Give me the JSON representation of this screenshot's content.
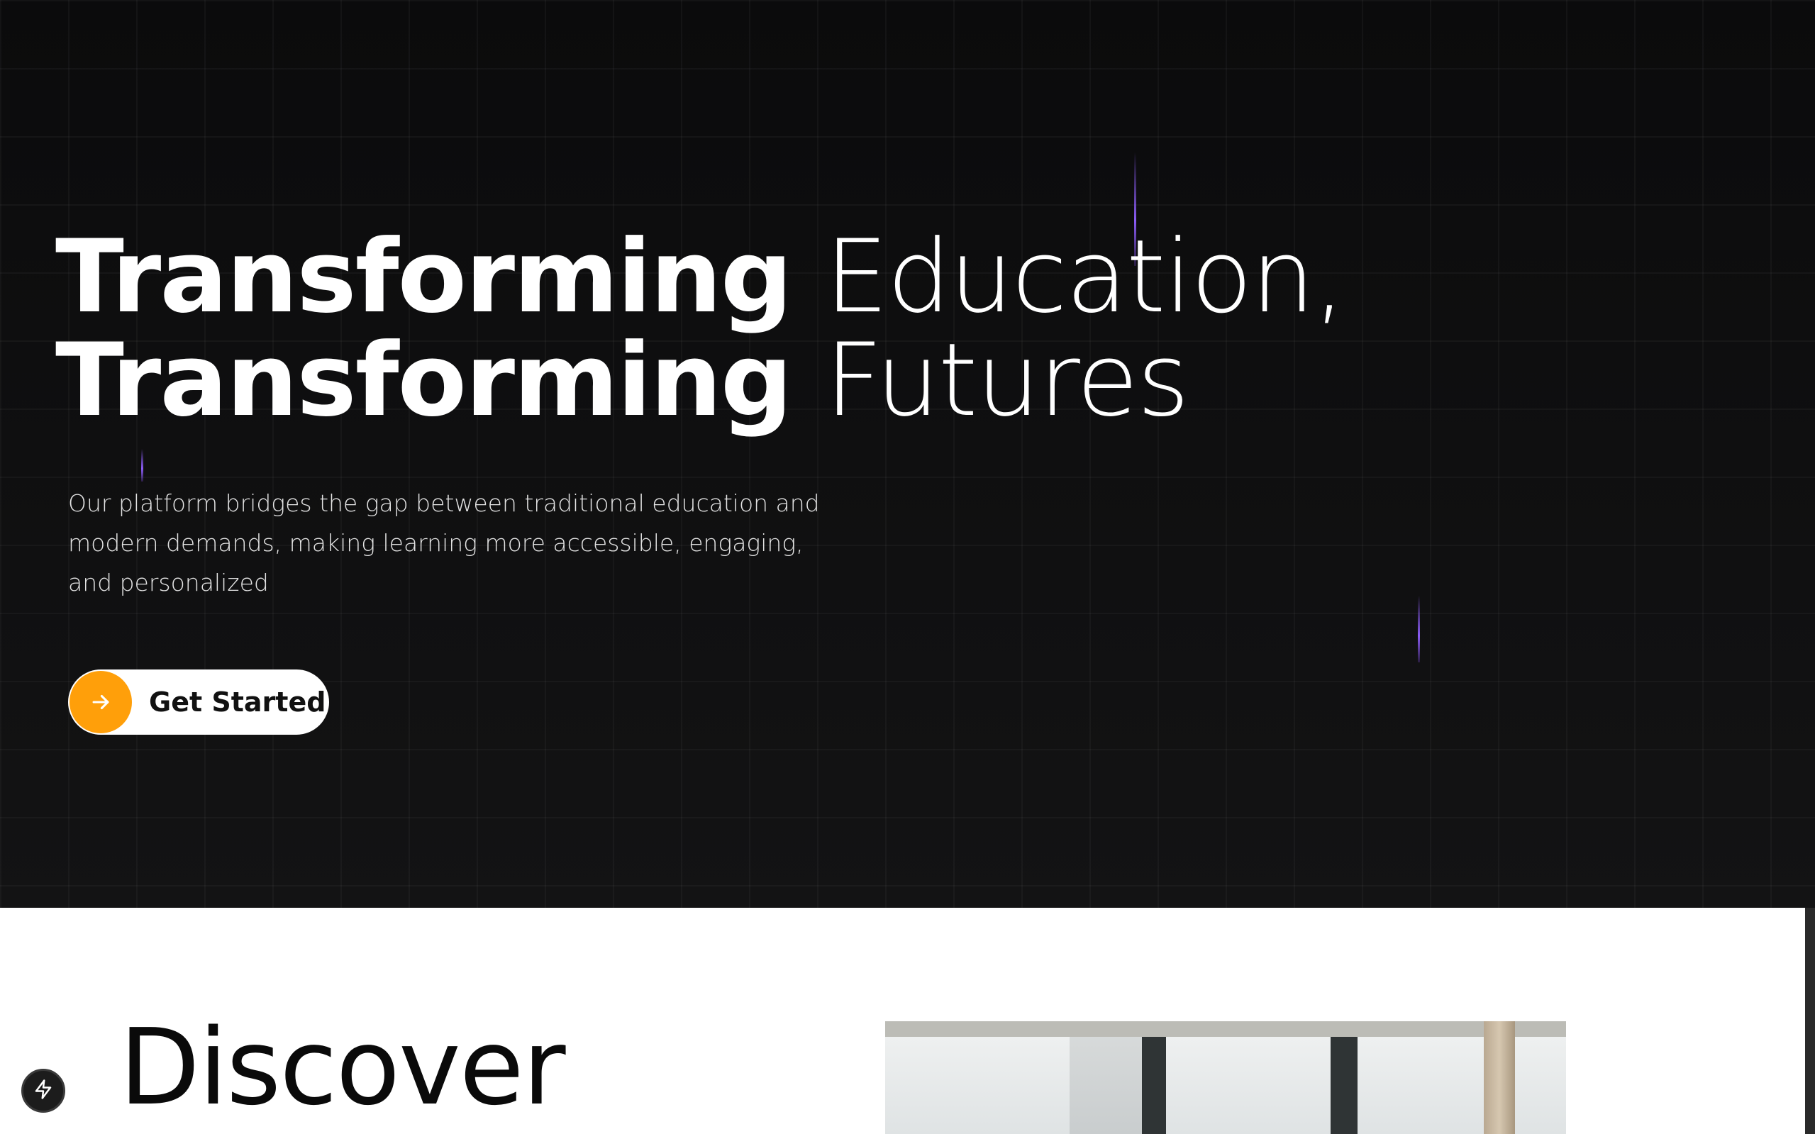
{
  "hero": {
    "line1_bold": "Transforming",
    "line1_light": "Education,",
    "line2_bold": "Transforming",
    "line2_light": "Futures",
    "subtitle": "Our platform bridges the gap between traditional education and modern demands, making learning more accessible, engaging, and personalized",
    "cta": {
      "label": "Get Started",
      "icon": "arrow-right-icon"
    }
  },
  "section2": {
    "heading": "Discover"
  },
  "badge": {
    "icon": "lightning-icon"
  },
  "colors": {
    "hero_bg": "#0b0b0c",
    "accent_orange": "#ff9f0a",
    "beam_purple": "#8b5cf6",
    "text_white": "#ffffff"
  }
}
